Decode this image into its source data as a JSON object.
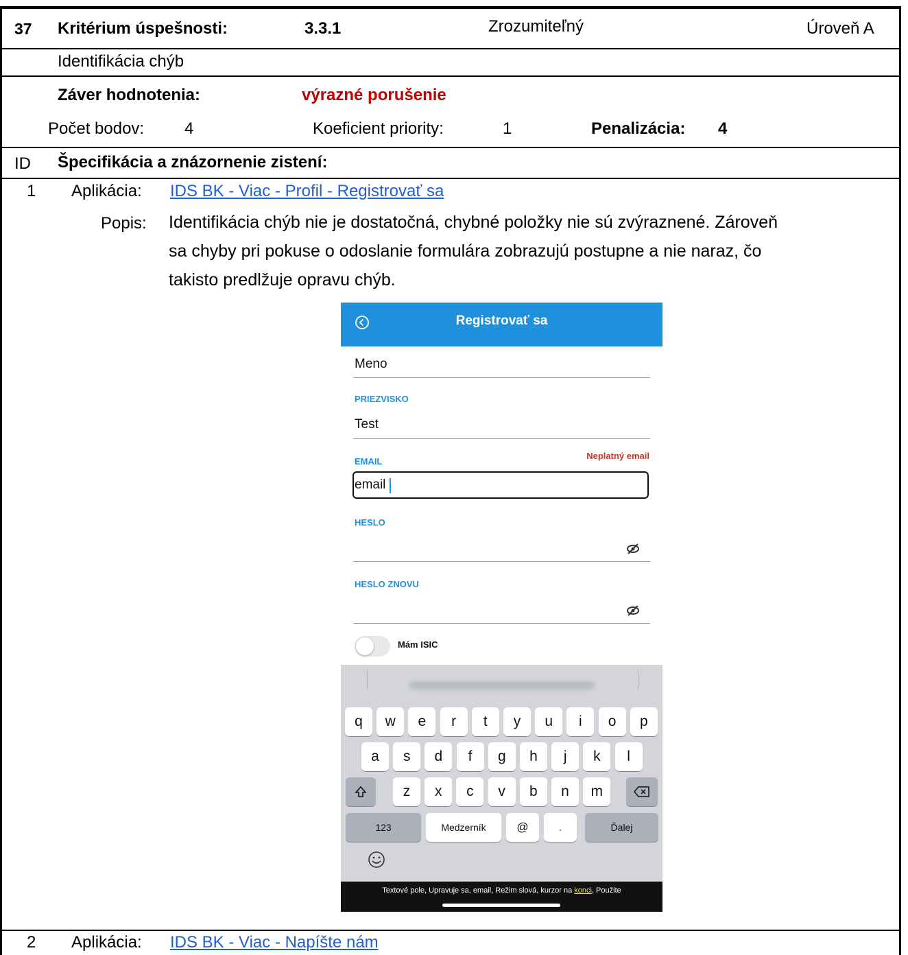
{
  "header": {
    "number": "37",
    "criterion_label": "Kritérium úspešnosti:",
    "criterion_code": "3.3.1",
    "principle": "Zrozumiteľný",
    "level": "Úroveň A"
  },
  "criterion_name": "Identifikácia chýb",
  "evaluation": {
    "conclusion_label": "Záver hodnotenia:",
    "conclusion_value": "výrazné porušenie",
    "points_label": "Počet bodov:",
    "points_value": "4",
    "priority_label": "Koeficient priority:",
    "priority_value": "1",
    "penalty_label": "Penalizácia:",
    "penalty_value": "4"
  },
  "findings_header": {
    "id_label": "ID",
    "title": "Špecifikácia a znázornenie zistení:"
  },
  "findings": [
    {
      "id": "1",
      "app_label": "Aplikácia:",
      "app_link": "IDS BK - Viac - Profil - Registrovať sa",
      "desc_label": "Popis:",
      "desc_lines": [
        "Identifikácia chýb nie je dostatočná, chybné položky nie sú zvýraznené. Zároveň",
        "sa chyby pri pokuse o odoslanie formulára zobrazujú postupne a nie naraz, čo",
        "takisto predlžuje opravu chýb."
      ]
    },
    {
      "id": "2",
      "app_label": "Aplikácia:",
      "app_link": "IDS BK - Viac - Napíšte nám"
    }
  ],
  "screenshot": {
    "title": "Registrovať sa",
    "first_name": "Meno",
    "surname_label": "PRIEZVISKO",
    "surname_value": "Test",
    "email_label": "EMAIL",
    "email_error": "Neplatný email",
    "email_value": "email",
    "password_label": "HESLO",
    "password_again_label": "HESLO ZNOVU",
    "isic_label": "Mám ISIC",
    "keyboard_row1": [
      "q",
      "w",
      "e",
      "r",
      "t",
      "y",
      "u",
      "i",
      "o",
      "p"
    ],
    "keyboard_row2": [
      "a",
      "s",
      "d",
      "f",
      "g",
      "h",
      "j",
      "k",
      "l"
    ],
    "keyboard_row3": [
      "z",
      "x",
      "c",
      "v",
      "b",
      "n",
      "m"
    ],
    "key_123": "123",
    "key_space": "Medzerník",
    "key_at": "@",
    "key_dot": ".",
    "key_next": "Ďalej",
    "voiceover_before": "Textové pole, Upravuje sa, email, Režim slová, kurzor na ",
    "voiceover_highlight": "konci",
    "voiceover_after": ", Použite",
    "header_color": "#1e90dc",
    "error_color": "#c0392b"
  },
  "colors": {
    "conclusion": "#c00000",
    "link": "#1f5fd0"
  }
}
